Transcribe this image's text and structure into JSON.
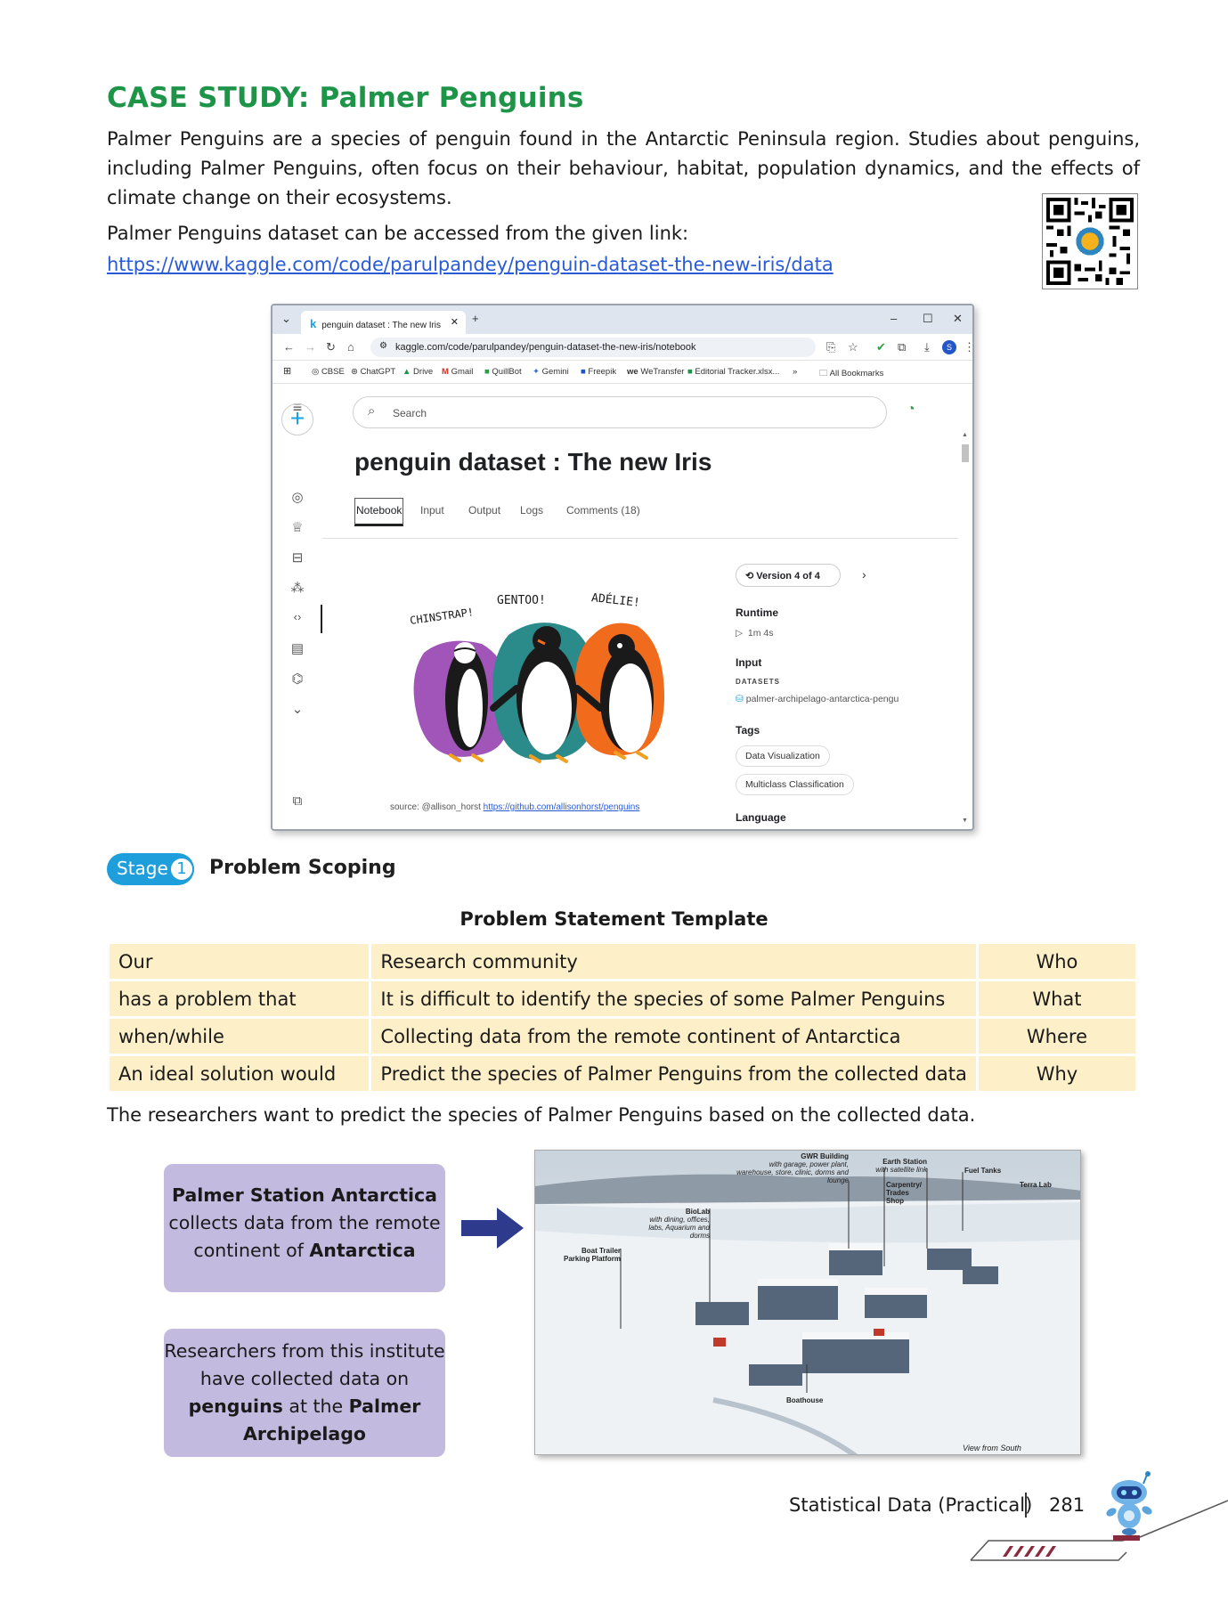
{
  "heading": "CASE STUDY: Palmer Penguins",
  "intro_paragraph": "Palmer Penguins are a species of penguin found in the Antarctic Peninsula region. Studies about penguins, including Palmer Penguins, often focus on their behaviour, habitat, population dynamics, and the effects of climate change on their ecosystems.",
  "dataset_sentence": "Palmer Penguins dataset can be accessed from the given link:",
  "dataset_link": "https://www.kaggle.com/code/parulpandey/penguin-dataset-the-new-iris/data",
  "browser": {
    "tab_title": "penguin dataset : The new Iris",
    "url": "kaggle.com/code/parulpandey/penguin-dataset-the-new-iris/notebook",
    "profile_initial": "S",
    "bookmarks": [
      "CBSE",
      "ChatGPT",
      "Drive",
      "Gmail",
      "QuillBot",
      "Gemini",
      "Freepik",
      "WeTransfer",
      "Editorial Tracker.xlsx...",
      "All Bookmarks"
    ],
    "search_placeholder": "Search",
    "notebook_title": "penguin dataset : The new Iris",
    "tabs": [
      "Notebook",
      "Input",
      "Output",
      "Logs",
      "Comments (18)"
    ],
    "illustration_labels": [
      "CHINSTRAP!",
      "GENTOO!",
      "ADÉLIE!"
    ],
    "source_prefix": "source: @allison_horst",
    "source_link": "https://github.com/allisonhorst/penguins",
    "version": "Version 4 of 4",
    "runtime_heading": "Runtime",
    "runtime_value": "1m 4s",
    "input_heading": "Input",
    "datasets_caption": "DATASETS",
    "dataset_name": "palmer-archipelago-antarctica-pengu",
    "tags_heading": "Tags",
    "tags": [
      "Data Visualization",
      "Multiclass Classification"
    ],
    "language_heading": "Language"
  },
  "stage": {
    "label": "Stage",
    "number": "1",
    "title": "Problem Scoping"
  },
  "template_title": "Problem Statement Template",
  "template_rows": [
    [
      "Our",
      "Research community",
      "Who"
    ],
    [
      "has a problem that",
      "It is difficult to identify the species of some Palmer Penguins",
      "What"
    ],
    [
      "when/while",
      "Collecting data from the remote continent of Antarctica",
      "Where"
    ],
    [
      "An ideal solution would",
      "Predict the species of Palmer Penguins from the collected data",
      "Why"
    ]
  ],
  "conclusion": "The researchers want to predict the species of Palmer Penguins based on the collected data.",
  "box1": {
    "line1": "Palmer Station Antarctica",
    "line2": "collects data from the remote",
    "line3_pre": "continent of ",
    "line3_bold": "Antarctica"
  },
  "box2": {
    "line1": "Researchers from this institute",
    "line2": "have collected data on",
    "line3_bold": "penguins",
    "line3_mid": " at the ",
    "line3_bold2": "Palmer",
    "line4_bold": "Archipelago"
  },
  "photo_labels": {
    "gwr_title": "GWR Building",
    "gwr_desc": "with garage, power plant, warehouse, store, clinic, dorms and lounge",
    "earth_title": "Earth Station",
    "earth_desc": "with satellite link",
    "fuel": "Fuel Tanks",
    "terra": "Terra Lab",
    "carpentry": "Carpentry/ Trades Shop",
    "biolab_title": "BioLab",
    "biolab_desc": "with dining, offices, labs, Aquarium and dorms",
    "boat_trailer": "Boat Trailer Parking Platform",
    "boathouse": "Boathouse",
    "view": "View from South"
  },
  "footer": {
    "chapter": "Statistical Data (Practical)",
    "page": "281"
  },
  "colors": {
    "heading_green": "#1e9448",
    "stage_blue": "#1e9fdc",
    "template_cell": "#fdefc7",
    "box_lavender": "#c3badf",
    "arrow_navy": "#2e3a8c"
  }
}
